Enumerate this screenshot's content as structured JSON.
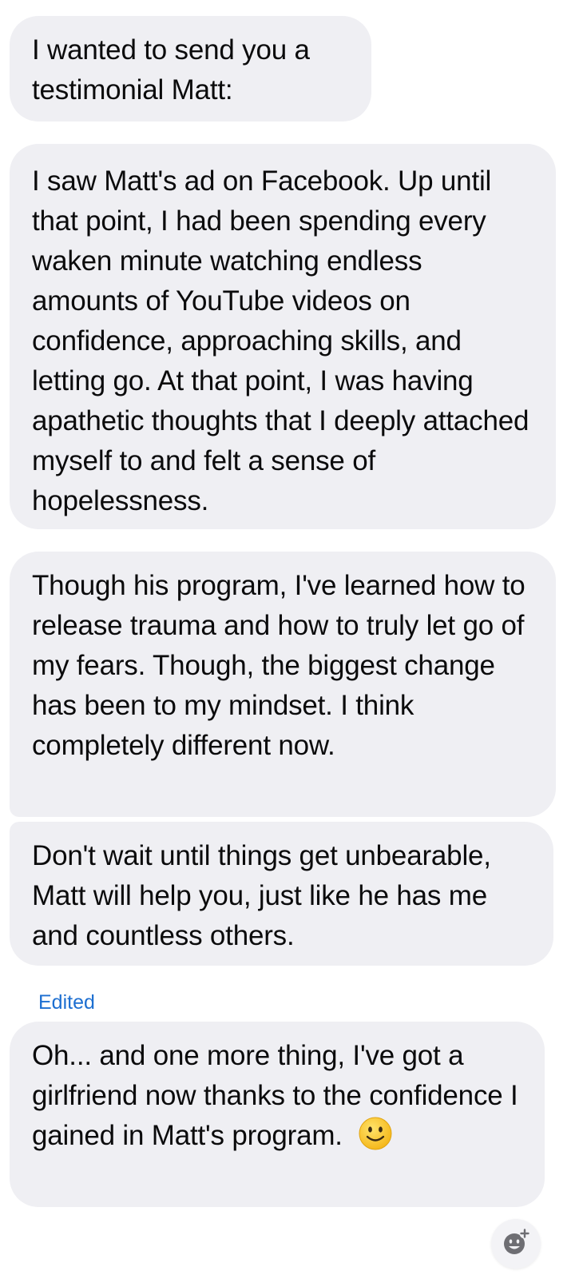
{
  "messages": [
    {
      "text": "I wanted to send you a testimonial Matt:"
    },
    {
      "text": "I saw Matt's ad on Facebook. Up until that point, I had been spending every waken minute watching endless amounts of YouTube videos on confidence, approaching skills, and letting go. At that point, I was having apathetic thoughts that I deeply attached myself to and felt a sense of hopelessness."
    },
    {
      "text": "Though his program, I've learned how to release trauma and how to truly let go of my fears. Though, the biggest change has been to my mindset. I think completely different now."
    },
    {
      "text": "Don't wait until things get unbearable, Matt will help you, just like he has me and countless others."
    },
    {
      "text": "Oh... and one more thing, I've got a girlfriend now thanks to the confidence I gained in Matt's program.",
      "emoji": "slightly-smiling-face-icon"
    }
  ],
  "edited_label": "Edited",
  "reaction_button": {
    "icon": "add-reaction-icon"
  },
  "colors": {
    "bubble_bg": "#efeff3",
    "text": "#0b0b0c",
    "edited": "#1d6fd1"
  }
}
